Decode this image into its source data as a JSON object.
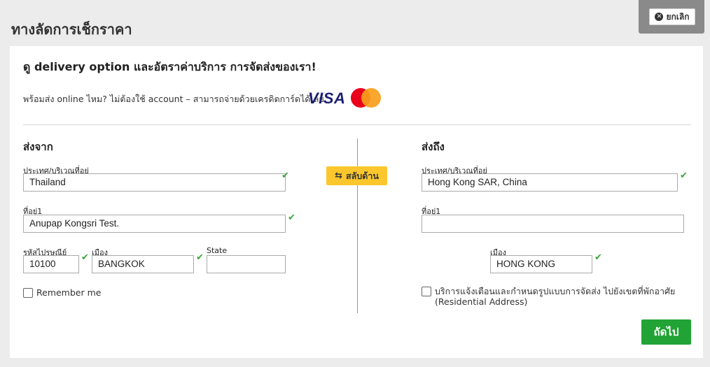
{
  "page": {
    "title": "ทางลัดการเช็กราคา",
    "cancel_label": "ยกเลิก"
  },
  "intro": {
    "headline": "ดู delivery option และอัตราค่าบริการ การจัดส่งของเรา!",
    "payment_text": "พร้อมส่ง online ไหม? ไม่ต้องใช้ account – สามารถจ่ายด้วยเครดิตการ์ดได้เลย",
    "visa_logo": "VISA",
    "mastercard_logo": "mastercard"
  },
  "from": {
    "title": "ส่งจาก",
    "country_label": "ประเทศ/บริเวณที่อยู่",
    "country_value": "Thailand",
    "address1_label": "ที่อยู่1",
    "address1_value": "Anupap Kongsri Test.",
    "postcode_label": "รหัสไปรษณีย์",
    "postcode_value": "10100",
    "city_label": "เมือง",
    "city_value": "BANGKOK",
    "state_label": "State",
    "state_value": "",
    "remember_label": "Remember me",
    "remember_checked": false
  },
  "swap": {
    "label": "สลับด้าน",
    "icon": "swap-arrows-icon"
  },
  "to": {
    "title": "ส่งถึง",
    "country_label": "ประเทศ/บริเวณที่อยู่",
    "country_value": "Hong Kong SAR, China",
    "address1_label": "ที่อยู่1",
    "address1_value": "",
    "city_label": "เมือง",
    "city_value": "HONG KONG",
    "residential_label": "บริการแจ้งเตือนและกำหนดรูปแบบการจัดส่ง ไปยังเขตที่พักอาศัย",
    "residential_sub": "(Residential Address)",
    "residential_checked": false
  },
  "actions": {
    "next_label": "ถัดไป"
  },
  "colors": {
    "accent_yellow": "#fcc72c",
    "next_green": "#21a336",
    "valid_check": "#3aa636"
  }
}
